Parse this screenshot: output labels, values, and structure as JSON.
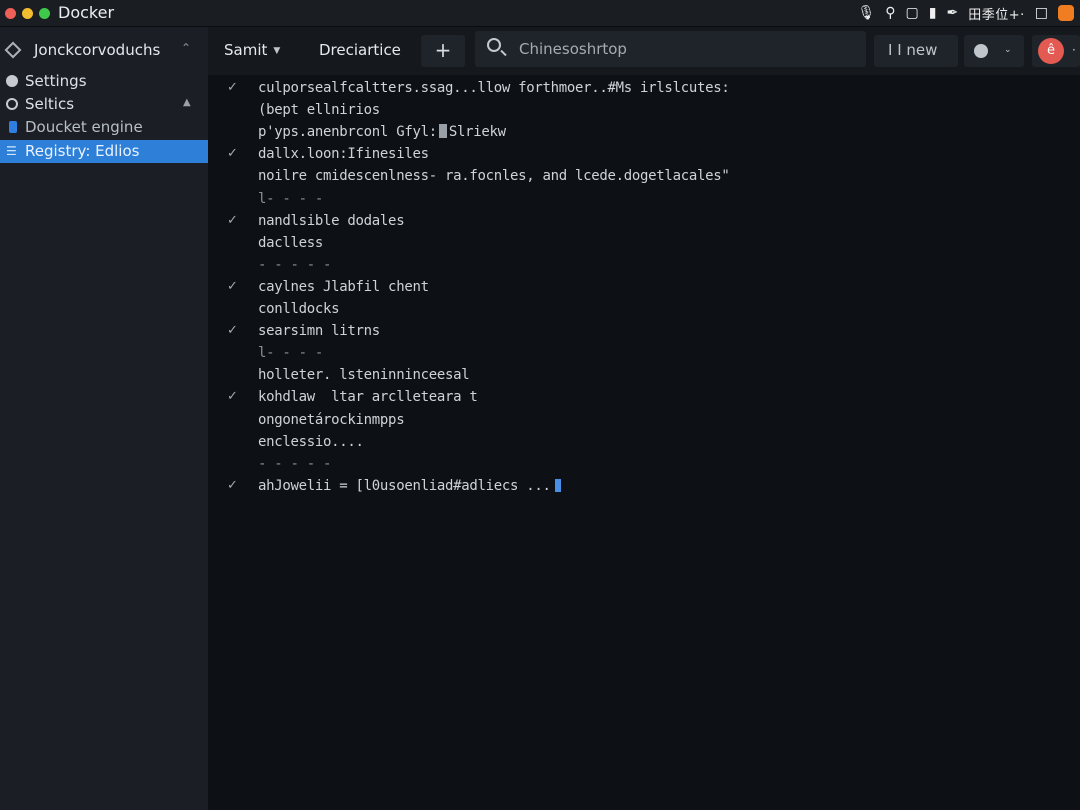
{
  "window": {
    "title": "Docker"
  },
  "menubar": {
    "icons": [
      "mic-icon",
      "search-icon",
      "square-icon",
      "clipboard-icon",
      "pen-icon",
      "input-method-icon",
      "window-icon",
      "lion-icon"
    ],
    "ime_text": "田季位+·"
  },
  "sidebar": {
    "header": "Jonckcorvoduchs",
    "items": [
      {
        "label": "Settings",
        "icon": "gear-icon"
      },
      {
        "label": "Seltics",
        "icon": "ring-icon"
      },
      {
        "label": "Doucket engine",
        "icon": "engine-icon"
      },
      {
        "label": "Registry: Edlios",
        "icon": "registry-icon"
      }
    ]
  },
  "toolbar": {
    "start_label": "Samit",
    "dev_label": "Dreciartice",
    "add_label": "+",
    "search_placeholder": "Chinesoshrtop",
    "new_label": "I I new",
    "avatar_letter": "ê",
    "more_label": "·"
  },
  "log": {
    "lines": [
      {
        "check": true,
        "text": "culporsealfcaltters.ssag...llow forthmoer..#Ms irlslcutes:"
      },
      {
        "check": false,
        "text": "(bept ellnirios"
      },
      {
        "check": false,
        "text": "p'yps.anenbrconl Gfyl:",
        "after": "Slriekw",
        "cursor": "block"
      },
      {
        "check": true,
        "text": "dallx.loon:Ifinesiles"
      },
      {
        "check": false,
        "text": "noilre cmidescenlness- ra.focnles, and lcede.dogetlacales\""
      },
      {
        "check": false,
        "text": "l- - - -",
        "dim": true
      },
      {
        "check": true,
        "text": "nandlsible dodales"
      },
      {
        "check": false,
        "text": "daclless"
      },
      {
        "check": false,
        "text": "- - - - -",
        "dim": true
      },
      {
        "check": true,
        "text": "caylnes Jlabfil chent"
      },
      {
        "check": false,
        "text": "conlldocks"
      },
      {
        "check": true,
        "text": "searsimn litrns"
      },
      {
        "check": false,
        "text": "l- - - -",
        "dim": true
      },
      {
        "check": false,
        "text": "holleter. lsteninninceesal"
      },
      {
        "check": true,
        "text": "kohdlaw  ltar arclleteara t"
      },
      {
        "check": false,
        "text": "ongonetárockinmpps"
      },
      {
        "check": false,
        "text": "enclessio...."
      },
      {
        "check": false,
        "text": "- - - - -",
        "dim": true
      },
      {
        "check": true,
        "text": "ahJowelii = [l0usoenliad#adliecs ...",
        "cursor": "blue"
      }
    ]
  },
  "colors": {
    "accent": "#2d7fd8",
    "background": "#0d1014",
    "sidebar": "#1b1f25",
    "avatar": "#e25a52"
  }
}
